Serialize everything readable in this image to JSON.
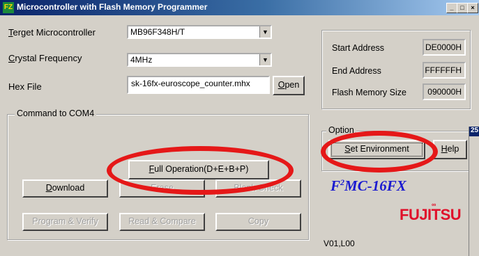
{
  "window": {
    "title": "Microcontroller with Flash Memory Programmer",
    "icon_text": "FZ",
    "min_glyph": "_",
    "max_glyph": "□",
    "close_glyph": "×"
  },
  "form": {
    "target_label_first": "T",
    "target_label_rest": "erget Microcontroller",
    "target_value": "MB96F348H/T",
    "crystal_label_first": "C",
    "crystal_label_rest": "rystal Frequency",
    "crystal_value": "4MHz",
    "hex_label": "Hex File",
    "hex_value": "sk-16fx-euroscope_counter.mhx",
    "open_first": "O",
    "open_rest": "pen",
    "dropdown_glyph": "▼"
  },
  "memory": {
    "start_label": "Start Address",
    "start_value": "DE0000H",
    "end_label": "End Address",
    "end_value": "FFFFFFH",
    "size_label": "Flash Memory Size",
    "size_value": "090000H"
  },
  "command": {
    "group_label": "Command to COM4",
    "full_first": "F",
    "full_rest": "ull Operation(D+E+B+P)",
    "download_first": "D",
    "download_rest": "ownload",
    "erase_label": "Erase",
    "blank_check_label": "Blank Check",
    "program_verify_label": "Program & Verify",
    "read_compare_label": "Read & Compare",
    "copy_label": "Copy"
  },
  "option": {
    "group_label": "Option",
    "set_env_first": "S",
    "set_env_rest": "et Environment",
    "help_first": "H",
    "help_rest": "elp"
  },
  "brand": {
    "product_prefix": "F",
    "product_sup": "2",
    "product_suffix": "MC-16FX",
    "company": "FUJITSU",
    "company_dot": "∞",
    "version": "V01,L00"
  },
  "background_window": {
    "title_fragment": "25"
  },
  "colors": {
    "highlight_ring": "#e51818",
    "brand_blue": "#1a1ad0",
    "fujitsu_red": "#e0102a",
    "titlebar": "#0a246a"
  }
}
